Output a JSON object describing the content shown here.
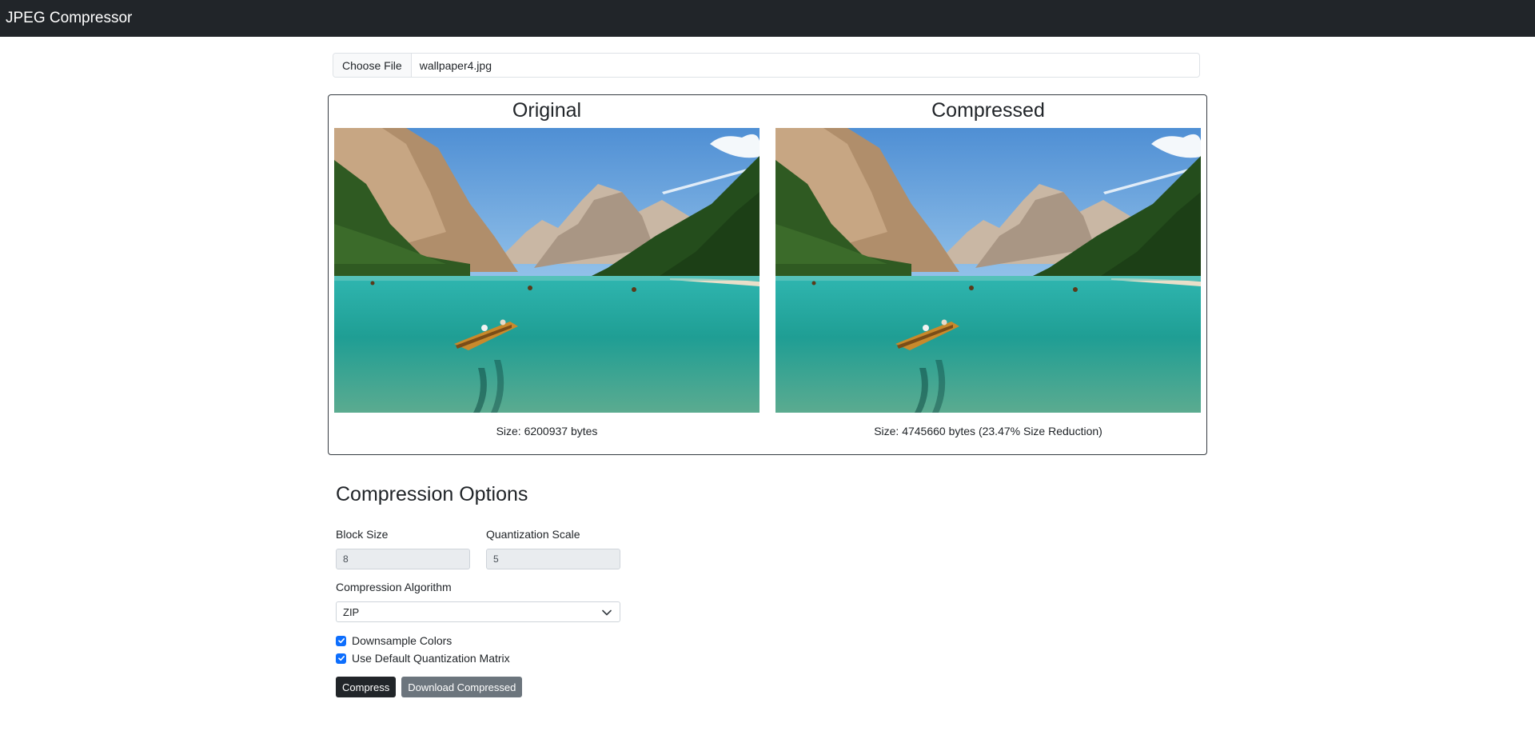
{
  "navbar": {
    "brand": "JPEG Compressor"
  },
  "file_input": {
    "button_label": "Choose File",
    "file_name": "wallpaper4.jpg"
  },
  "original": {
    "title": "Original",
    "size_text": "Size: 6200937 bytes"
  },
  "compressed": {
    "title": "Compressed",
    "size_text": "Size: 4745660 bytes (23.47% Size Reduction)"
  },
  "options": {
    "heading": "Compression Options",
    "block_size": {
      "label": "Block Size",
      "value": "8"
    },
    "quant_scale": {
      "label": "Quantization Scale",
      "value": "5"
    },
    "algorithm": {
      "label": "Compression Algorithm",
      "selected": "ZIP"
    },
    "downsample": {
      "label": "Downsample Colors",
      "checked": true
    },
    "default_matrix": {
      "label": "Use Default Quantization Matrix",
      "checked": true
    }
  },
  "buttons": {
    "compress": "Compress",
    "download": "Download Compressed"
  },
  "colors": {
    "navbar": "#212529",
    "checkbox": "#0d6efd",
    "secondary_button": "#6c757d"
  },
  "icons": {
    "select": "chevron-down-icon",
    "check": "check-icon"
  }
}
